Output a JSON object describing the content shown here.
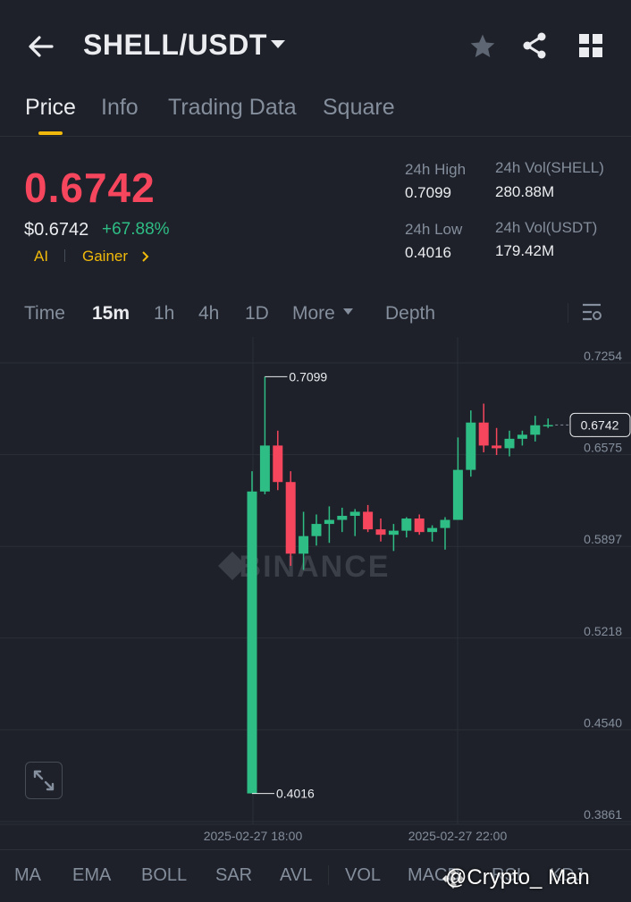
{
  "header": {
    "pair": "SHELL/USDT",
    "icons": [
      "back-arrow-icon",
      "caret-down-icon",
      "star-icon",
      "share-icon",
      "grid-icon"
    ]
  },
  "tabs": [
    {
      "label": "Price",
      "active": true
    },
    {
      "label": "Info",
      "active": false
    },
    {
      "label": "Trading Data",
      "active": false
    },
    {
      "label": "Square",
      "active": false
    }
  ],
  "ticker": {
    "last_price": "0.6742",
    "usd_price": "$0.6742",
    "change": "+67.88%",
    "tags": [
      "AI",
      "Gainer"
    ],
    "high_label": "24h High",
    "high_value": "0.7099",
    "low_label": "24h Low",
    "low_value": "0.4016",
    "vol_base_label": "24h Vol(SHELL)",
    "vol_base_value": "280.88M",
    "vol_quote_label": "24h Vol(USDT)",
    "vol_quote_value": "179.42M"
  },
  "timebar": [
    {
      "label": "Time",
      "active": false
    },
    {
      "label": "15m",
      "active": true
    },
    {
      "label": "1h",
      "active": false
    },
    {
      "label": "4h",
      "active": false
    },
    {
      "label": "1D",
      "active": false
    },
    {
      "label": "More",
      "active": false
    },
    {
      "label": "Depth",
      "active": false
    }
  ],
  "colors": {
    "up": "#2ebd85",
    "down": "#f6465d",
    "accent": "#f0b90b",
    "bg": "#1e2129"
  },
  "chart_data": {
    "type": "candlestick",
    "watermark": "BINANCE",
    "y_ticks": [
      "0.7254",
      "0.6575",
      "0.5897",
      "0.5218",
      "0.4540",
      "0.3861"
    ],
    "ylim": [
      0.3861,
      0.7254
    ],
    "x_ticks": [
      "2025-02-27 18:00",
      "2025-02-27 22:00"
    ],
    "current_price_label": "0.6742",
    "high_marker": "0.7099",
    "low_marker": "0.4016",
    "candles": [
      {
        "o": 0.4016,
        "h": 0.64,
        "l": 0.4016,
        "c": 0.625
      },
      {
        "o": 0.625,
        "h": 0.7099,
        "l": 0.623,
        "c": 0.659
      },
      {
        "o": 0.659,
        "h": 0.67,
        "l": 0.626,
        "c": 0.632
      },
      {
        "o": 0.632,
        "h": 0.64,
        "l": 0.57,
        "c": 0.579
      },
      {
        "o": 0.579,
        "h": 0.61,
        "l": 0.567,
        "c": 0.592
      },
      {
        "o": 0.592,
        "h": 0.608,
        "l": 0.585,
        "c": 0.601
      },
      {
        "o": 0.601,
        "h": 0.614,
        "l": 0.587,
        "c": 0.604
      },
      {
        "o": 0.604,
        "h": 0.613,
        "l": 0.595,
        "c": 0.607
      },
      {
        "o": 0.607,
        "h": 0.612,
        "l": 0.592,
        "c": 0.61
      },
      {
        "o": 0.61,
        "h": 0.615,
        "l": 0.595,
        "c": 0.597
      },
      {
        "o": 0.597,
        "h": 0.605,
        "l": 0.588,
        "c": 0.593
      },
      {
        "o": 0.593,
        "h": 0.601,
        "l": 0.581,
        "c": 0.596
      },
      {
        "o": 0.596,
        "h": 0.606,
        "l": 0.591,
        "c": 0.605
      },
      {
        "o": 0.605,
        "h": 0.608,
        "l": 0.593,
        "c": 0.595
      },
      {
        "o": 0.595,
        "h": 0.6,
        "l": 0.588,
        "c": 0.598
      },
      {
        "o": 0.598,
        "h": 0.606,
        "l": 0.582,
        "c": 0.604
      },
      {
        "o": 0.604,
        "h": 0.665,
        "l": 0.604,
        "c": 0.641
      },
      {
        "o": 0.641,
        "h": 0.685,
        "l": 0.636,
        "c": 0.676
      },
      {
        "o": 0.676,
        "h": 0.69,
        "l": 0.654,
        "c": 0.659
      },
      {
        "o": 0.659,
        "h": 0.672,
        "l": 0.652,
        "c": 0.657
      },
      {
        "o": 0.657,
        "h": 0.67,
        "l": 0.651,
        "c": 0.664
      },
      {
        "o": 0.664,
        "h": 0.67,
        "l": 0.659,
        "c": 0.667
      },
      {
        "o": 0.667,
        "h": 0.681,
        "l": 0.662,
        "c": 0.674
      },
      {
        "o": 0.674,
        "h": 0.679,
        "l": 0.672,
        "c": 0.6742
      }
    ]
  },
  "indicators": [
    "MA",
    "EMA",
    "BOLL",
    "SAR",
    "AVL",
    "VOL",
    "MACD",
    "RSI",
    "KDJ"
  ],
  "overlay_credit": "@Crypto_ Man"
}
